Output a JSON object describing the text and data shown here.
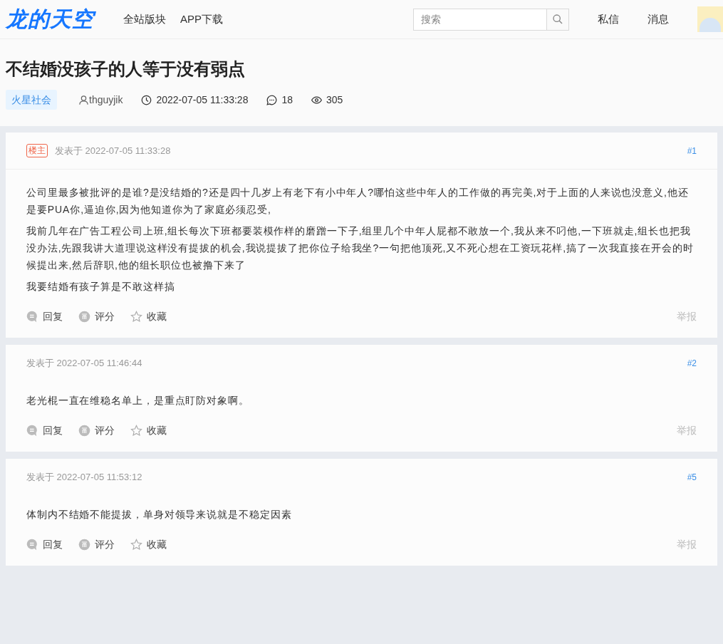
{
  "header": {
    "logo": "龙的天空",
    "nav": [
      "全站版块",
      "APP下载"
    ],
    "search": {
      "placeholder": "搜索"
    },
    "links": [
      "私信",
      "消息"
    ]
  },
  "thread": {
    "title": "不结婚没孩子的人等于没有弱点",
    "category": "火星社会",
    "author": "thguyjik",
    "time": "2022-07-05 11:33:28",
    "replies": "18",
    "views": "305"
  },
  "posts": [
    {
      "op_badge": "楼主",
      "posted": "发表于 2022-07-05 11:33:28",
      "floor": "#1",
      "paragraphs": [
        "公司里最多被批评的是谁?是没结婚的?还是四十几岁上有老下有小中年人?哪怕这些中年人的工作做的再完美,对于上面的人来说也没意义,他还是要PUA你,逼迫你,因为他知道你为了家庭必须忍受,",
        "我前几年在广告工程公司上班,组长每次下班都要装模作样的磨蹭一下子,组里几个中年人屁都不敢放一个,我从来不叼他,一下班就走,组长也把我没办法,先跟我讲大道理说这样没有提拔的机会,我说提拔了把你位子给我坐?一句把他顶死,又不死心想在工资玩花样,搞了一次我直接在开会的时候提出来,然后辞职,他的组长职位也被撸下来了",
        "我要结婚有孩子算是不敢这样搞"
      ],
      "actions": [
        "回复",
        "评分",
        "收藏"
      ],
      "report": "举报"
    },
    {
      "posted": "发表于 2022-07-05 11:46:44",
      "floor": "#2",
      "paragraphs": [
        "老光棍一直在维稳名单上，是重点盯防对象啊。"
      ],
      "actions": [
        "回复",
        "评分",
        "收藏"
      ],
      "report": "举报"
    },
    {
      "posted": "发表于 2022-07-05 11:53:12",
      "floor": "#5",
      "paragraphs": [
        "体制内不结婚不能提拔，单身对领导来说就是不稳定因素"
      ],
      "actions": [
        "回复",
        "评分",
        "收藏"
      ],
      "report": "举报"
    }
  ]
}
